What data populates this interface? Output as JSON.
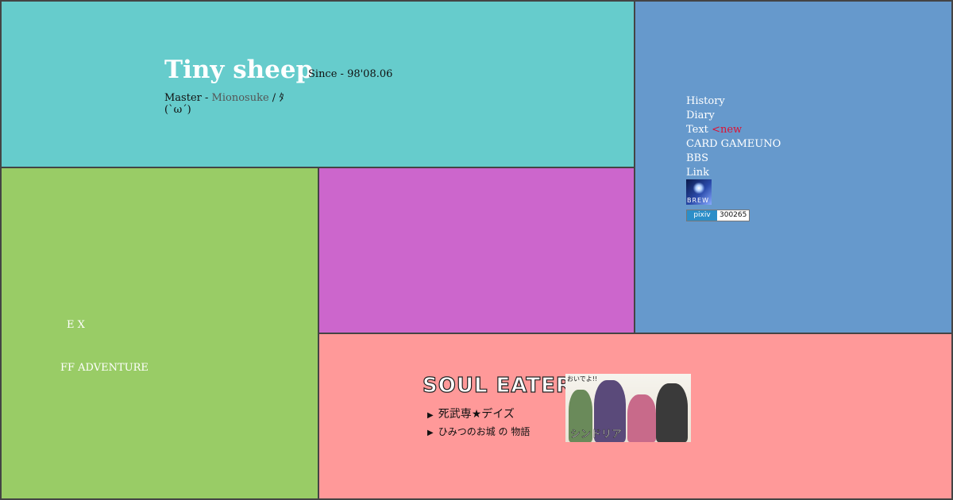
{
  "header": {
    "site_title": "Tiny sheep",
    "since": "Since - 98'08.06",
    "master_label": "Master - ",
    "master_name": "Mionosuke",
    "master_suffix": " / ﾀ",
    "face": "(`ω´)"
  },
  "nav": {
    "items": [
      {
        "label": "History"
      },
      {
        "label": "Diary"
      },
      {
        "label": "Text",
        "badge": "<new"
      },
      {
        "label": "CARD GAMEUNO"
      },
      {
        "label": "BBS"
      },
      {
        "label": "Link"
      }
    ],
    "brew_banner": "BREW",
    "pixiv": {
      "logo": "pixiv",
      "count": "300265"
    }
  },
  "green_panel": {
    "links": [
      "E X",
      "FF ADVENTURE"
    ]
  },
  "pink_panel": {
    "soul_eater": {
      "logo": "SOUL EATER",
      "line1": "死武専★デイズ",
      "line2": "ひみつのお城 の 物語"
    },
    "magi": {
      "tag": "おいでよ!!",
      "name": "シンドリア"
    }
  },
  "colors": {
    "header_bg": "#66cccc",
    "nav_bg": "#6699cc",
    "green_bg": "#99cc66",
    "purple_bg": "#cc66cc",
    "pink_bg": "#ff9999",
    "new_badge": "#dd1133"
  }
}
